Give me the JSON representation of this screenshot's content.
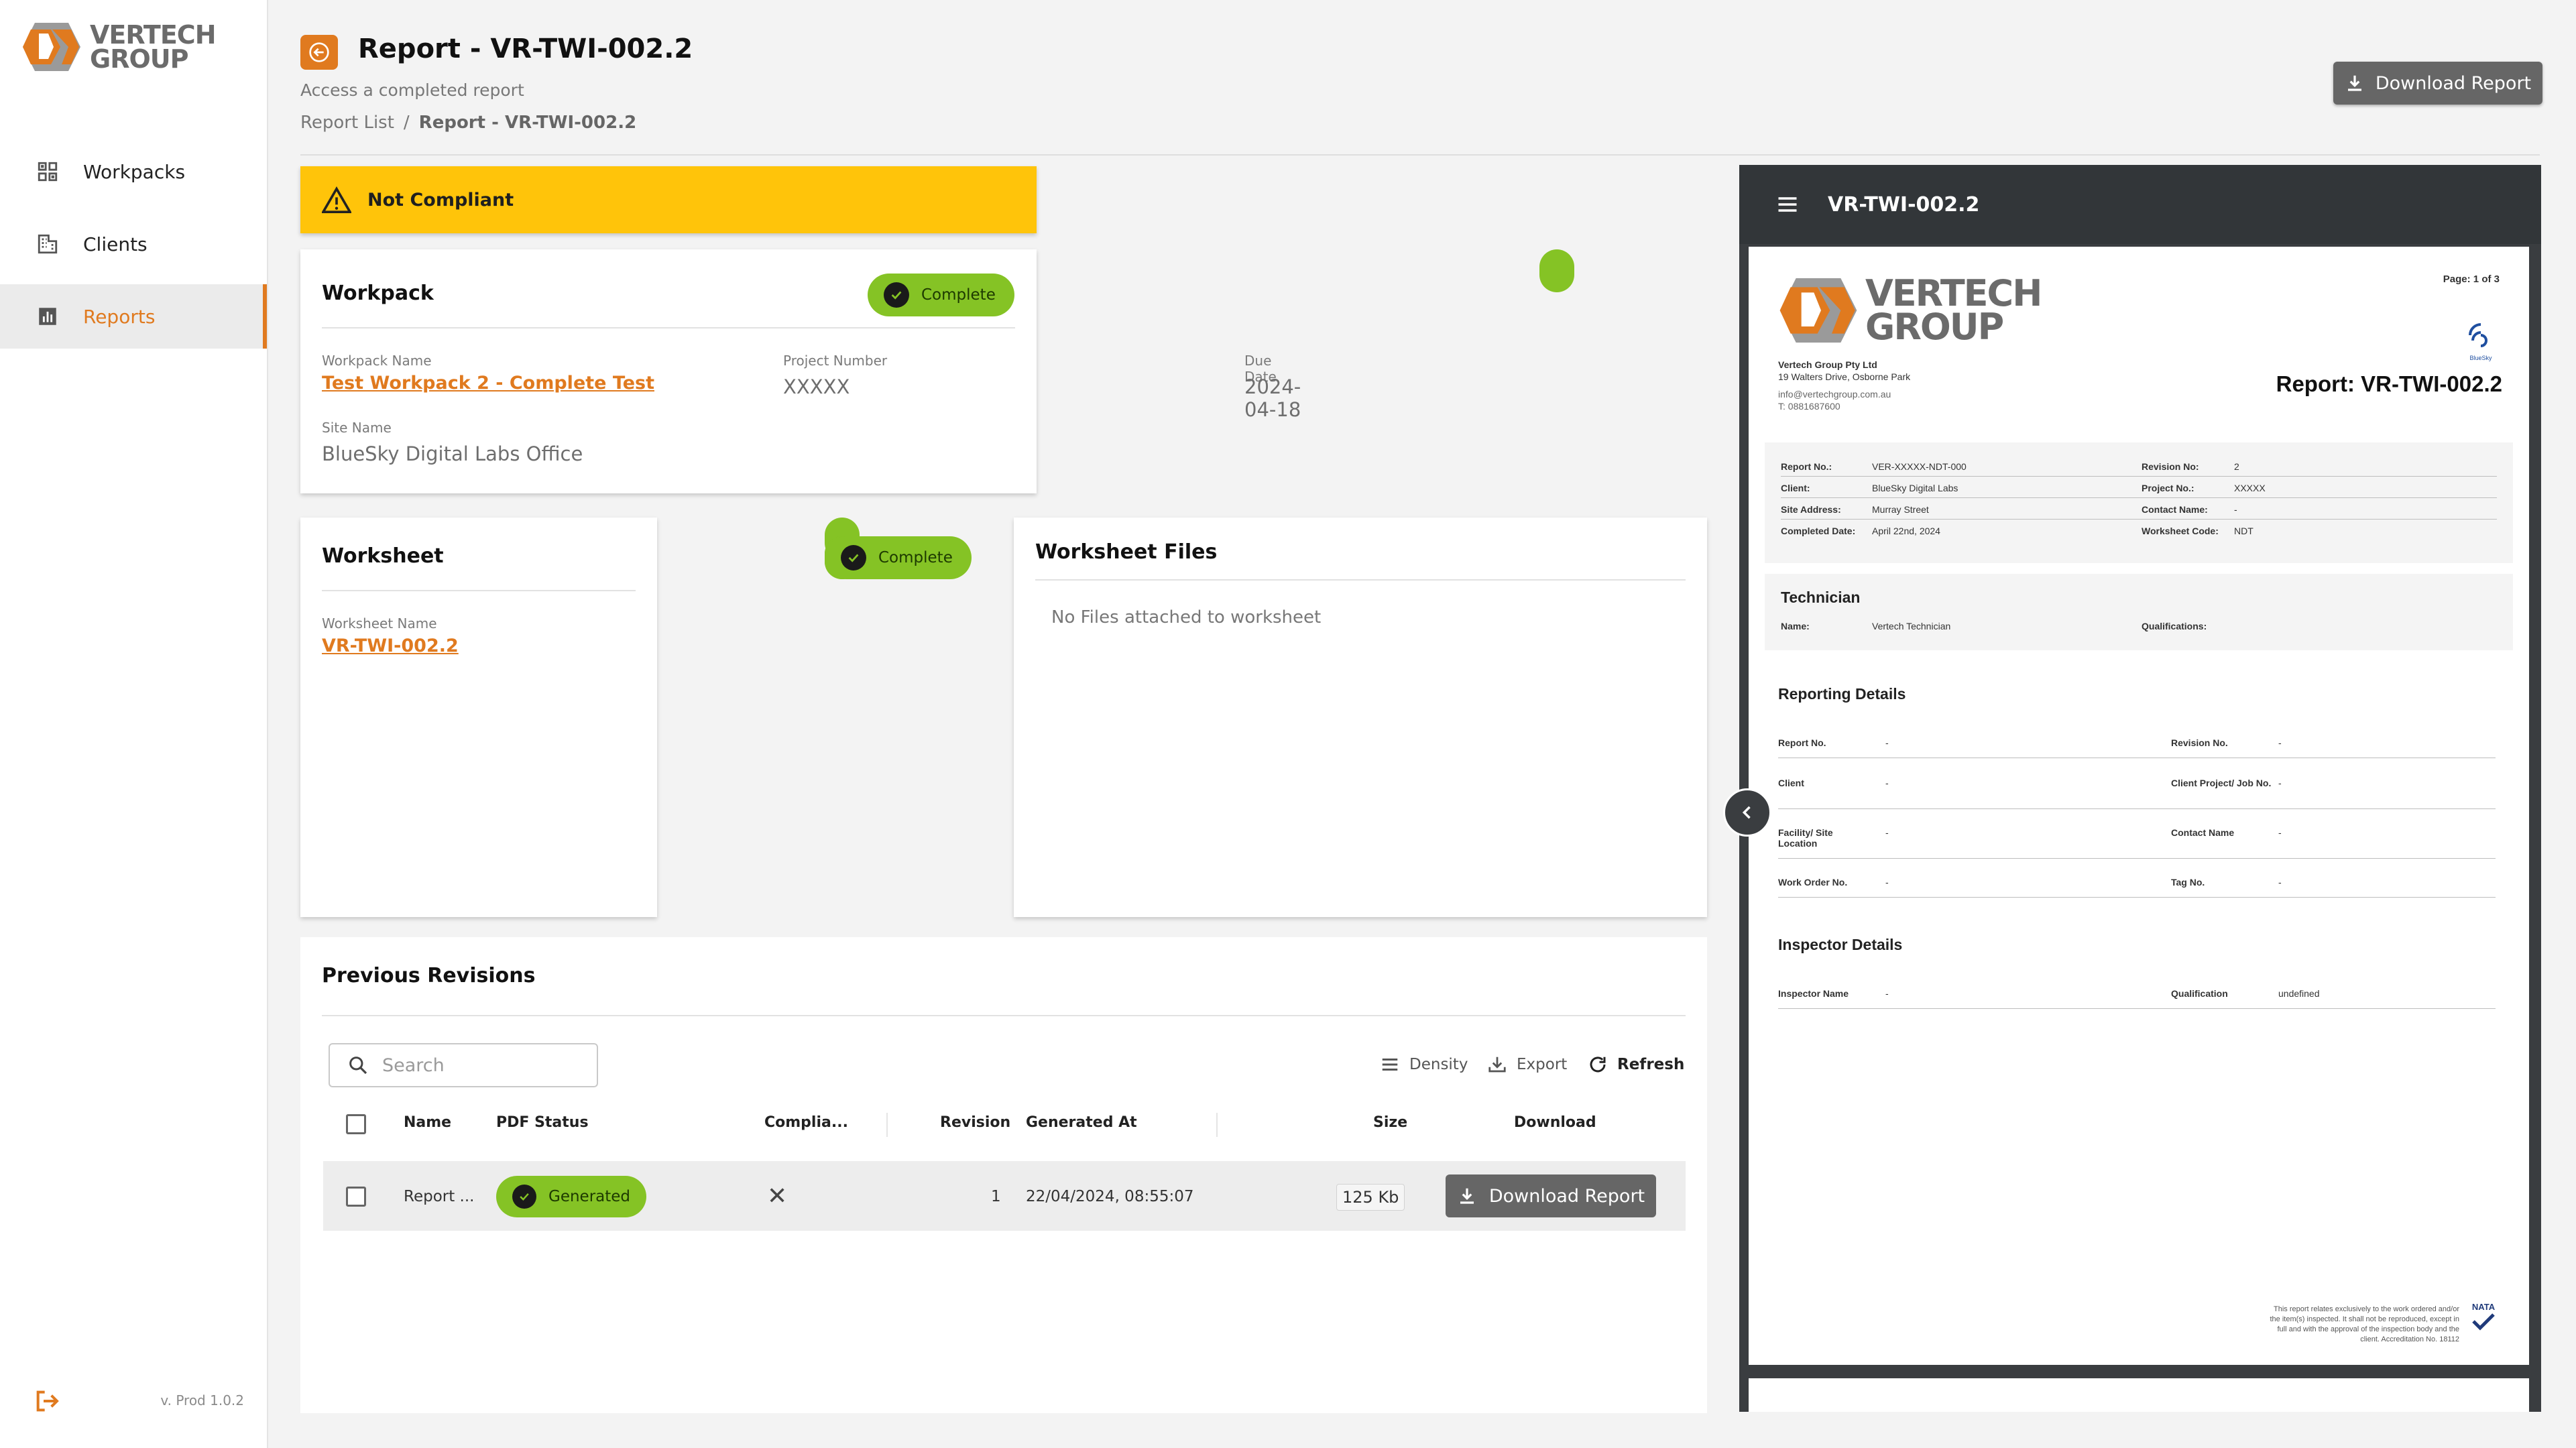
{
  "app": {
    "logo_line1": "VERTECH",
    "logo_line2": "GROUP",
    "version": "v. Prod 1.0.2",
    "accent_color": "#e07a1f"
  },
  "sidebar": {
    "items": [
      {
        "label": "Workpacks",
        "icon": "workpacks-icon"
      },
      {
        "label": "Clients",
        "icon": "building-icon"
      },
      {
        "label": "Reports",
        "icon": "bar-chart-icon",
        "active": true
      }
    ]
  },
  "header": {
    "title": "Report - VR-TWI-002.2",
    "subtitle": "Access a completed report",
    "breadcrumb": [
      "Report List",
      "Report - VR-TWI-002.2"
    ],
    "breadcrumb_sep": "/",
    "download_label": "Download Report"
  },
  "banner": {
    "label": "Not Compliant",
    "color": "#ffc40a"
  },
  "workpack": {
    "title": "Workpack",
    "status": "Complete",
    "fields": {
      "name_label": "Workpack Name",
      "name_value": "Test Workpack 2 - Complete Test",
      "project_label": "Project Number",
      "project_value": "XXXXX",
      "due_label": "Due Date",
      "due_value": "2024-04-18",
      "site_label": "Site Name",
      "site_value": "BlueSky Digital Labs Office"
    }
  },
  "worksheet": {
    "title": "Worksheet",
    "status": "Complete",
    "name_label": "Worksheet Name",
    "name_value": "VR-TWI-002.2"
  },
  "worksheet_files": {
    "title": "Worksheet Files",
    "empty_text": "No Files attached to worksheet"
  },
  "revisions": {
    "title": "Previous Revisions",
    "search_placeholder": "Search",
    "toolbar": {
      "density": "Density",
      "export": "Export",
      "refresh": "Refresh"
    },
    "columns": [
      "Name",
      "PDF Status",
      "Complia...",
      "Revision",
      "Generated At",
      "Size",
      "Download"
    ],
    "rows": [
      {
        "name": "Report ...",
        "pdf_status": "Generated",
        "compliant": "✕",
        "revision": "1",
        "generated_at": "22/04/2024, 08:55:07",
        "size": "125  Kb",
        "download_label": "Download Report"
      }
    ]
  },
  "viewer": {
    "title": "VR-TWI-002.2",
    "page": {
      "page_label": "Page: 1 of 3",
      "company": "Vertech Group Pty Ltd",
      "address": "19 Walters Drive, Osborne Park",
      "email": "info@vertechgroup.com.au",
      "phone": "T: 0881687600",
      "report_heading": "Report: VR-TWI-002.2",
      "client_logo_text": "BlueSky",
      "info": {
        "report_no_label": "Report No.:",
        "report_no_value": "VER-XXXXX-NDT-000",
        "revision_label": "Revision No:",
        "revision_value": "2",
        "client_label": "Client:",
        "client_value": "BlueSky Digital Labs",
        "project_label": "Project No.:",
        "project_value": "XXXXX",
        "site_label": "Site Address:",
        "site_value": "Murray Street",
        "contact_label": "Contact Name:",
        "contact_value": "-",
        "completed_label": "Completed Date:",
        "completed_value": "April 22nd, 2024",
        "worksheet_code_label": "Worksheet Code:",
        "worksheet_code_value": "NDT"
      },
      "technician": {
        "heading": "Technician",
        "name_label": "Name:",
        "name_value": "Vertech Technician",
        "qual_label": "Qualifications:"
      },
      "reporting": {
        "heading": "Reporting Details",
        "report_no": "Report No.",
        "revision_no": "Revision No.",
        "client": "Client",
        "client_project": "Client Project/ Job No.",
        "facility": "Facility/ Site Location",
        "contact": "Contact Name",
        "work_order": "Work Order No.",
        "tag": "Tag No.",
        "dash": "-"
      },
      "inspector": {
        "heading": "Inspector Details",
        "name_label": "Inspector Name",
        "name_value": "-",
        "qual_label": "Qualification",
        "qual_value": "undefined"
      },
      "footer_text_1": "This report relates exclusively to the work ordered and/or",
      "footer_text_2": "the item(s) inspected. It shall not be reproduced, except in",
      "footer_text_3": "full and with the approval of the inspection body and the",
      "footer_text_4": "client. Accreditation No. 18112",
      "nata_text": "NATA"
    }
  }
}
